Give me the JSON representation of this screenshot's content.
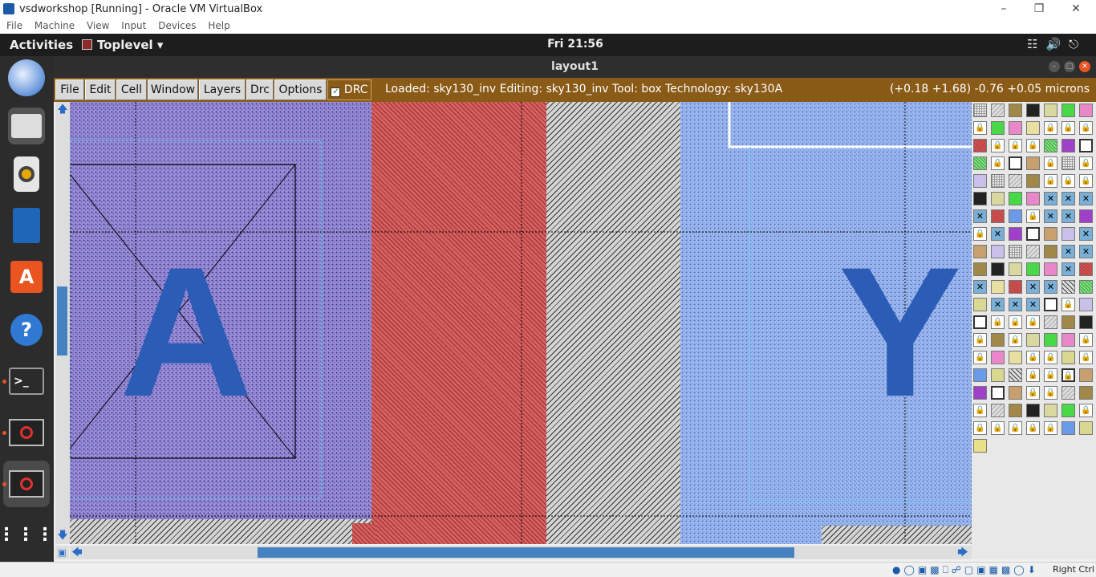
{
  "vbox": {
    "title": "vsdworkshop [Running] - Oracle VM VirtualBox",
    "menu": [
      "File",
      "Machine",
      "View",
      "Input",
      "Devices",
      "Help"
    ],
    "host_key": "Right Ctrl"
  },
  "gnome": {
    "activities": "Activities",
    "app_menu": "Toplevel",
    "clock": "Fri 21:56"
  },
  "dock": {
    "items": [
      "thunderbird-icon",
      "files-icon",
      "rhythmbox-icon",
      "writer-icon",
      "software-icon",
      "help-icon",
      "terminal-icon",
      "magic-icon",
      "magic-icon",
      "app-grid-icon"
    ]
  },
  "window": {
    "title": "layout1"
  },
  "magic": {
    "menu": [
      "File",
      "Edit",
      "Cell",
      "Window",
      "Layers",
      "Drc",
      "Options"
    ],
    "drc_toggle": "DRC",
    "drc_checked": true,
    "status": "Loaded: sky130_inv Editing: sky130_inv Tool: box  Technology: sky130A",
    "coords": "(+0.18 +1.68) -0.76 +0.05 microns"
  },
  "layout": {
    "labels": [
      "A",
      "Y"
    ]
  },
  "colors": {
    "menubar": "#8a5a17",
    "metal": "#9a8ed8",
    "poly": "#d86060",
    "diff": "#9cb8f0",
    "label": "#2b5cb6"
  }
}
